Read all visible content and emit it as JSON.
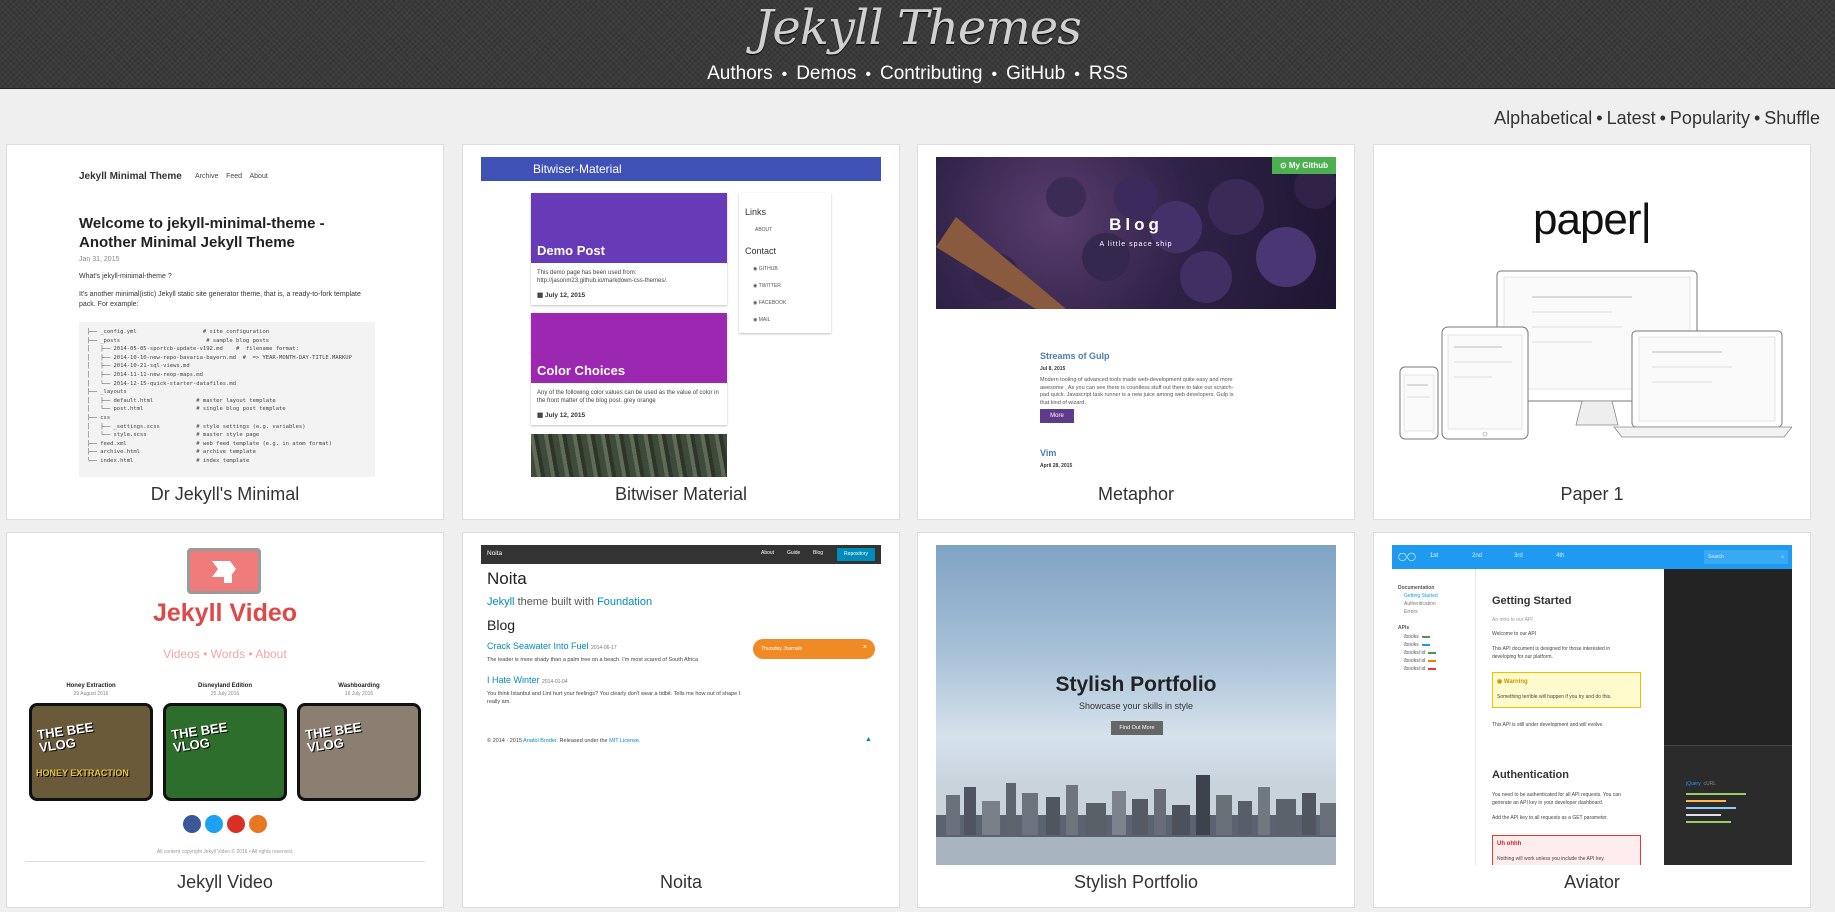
{
  "header": {
    "title": "Jekyll Themes",
    "nav": [
      "Authors",
      "Demos",
      "Contributing",
      "GitHub",
      "RSS"
    ]
  },
  "sort": [
    "Alphabetical",
    "Latest",
    "Popularity",
    "Shuffle"
  ],
  "themes": [
    {
      "title": "Dr Jekyll's Minimal",
      "preview": {
        "brand": "Jekyll Minimal Theme",
        "nav": [
          "Archive",
          "Feed",
          "About"
        ],
        "heading": "Welcome to jekyll-minimal-theme - Another Minimal Jekyll Theme",
        "date": "Jan 31, 2015",
        "whats": "What's jekyll-minimal-theme ?",
        "intro": "It's another minimal(istic) Jekyll static site generator theme, that is, a ready-to-fork template pack. For example:",
        "tree": [
          "├── _config.yml                    # site configuration",
          "├── _posts                          # sample blog posts",
          "│   ├── 2014-05-05-sportcb-update-v192.md    #  filename format:",
          "│   ├── 2014-10-10-new-repo-bavaria-bayern.md  #  => YEAR-MONTH-DAY-TITLE.MARKUP",
          "│   ├── 2014-10-21-sql-views.md",
          "│   ├── 2014-11-11-new-reop-maps.md",
          "│   └── 2014-12-15-quick-starter-datafiles.md",
          "├── _layouts",
          "│   ├── default.html             # master layout template",
          "│   └── post.html                # single blog post template",
          "├── css",
          "│   ├── _settings.scss           # style settings (e.g. variables)",
          "│   └── style.scss               # master style page",
          "├── feed.xml                     # web feed template (e.g. in atom format)",
          "├── archive.html                 # archive template",
          "└── index.html                   # index template"
        ]
      }
    },
    {
      "title": "Bitwiser Material",
      "preview": {
        "bar": "Bitwiser-Material",
        "post1": {
          "title": "Demo Post",
          "text": "This demo page has been used from: http://jasonm23.github.io/markdown-css-themes/.",
          "date": "July 12, 2015"
        },
        "post2": {
          "title": "Color Choices",
          "text": "Any of the following color values can be used as the value of color in the front matter of the blog post. grey orange",
          "date": "July 12, 2015"
        },
        "links_title": "Links",
        "about": "ABOUT",
        "contact_title": "Contact",
        "contacts": [
          "GITHUB",
          "TWITTER",
          "FACEBOOK",
          "MAIL"
        ]
      }
    },
    {
      "title": "Metaphor",
      "preview": {
        "github_button": "My Github",
        "hero_title": "Blog",
        "hero_sub": "A little space ship",
        "post1_title": "Streams of Gulp",
        "post1_date": "Jul 8, 2015",
        "post1_text": "Modern tooling of advanced tools made web-development quite easy and more awesome . As you can see there is countless stuff out there to take our scratch-pad quick. Javascript task runner is a new juice among web developers. Gulp is that kind of wizard.",
        "more": "More",
        "post2_title": "Vim",
        "post2_date": "April 28, 2015"
      }
    },
    {
      "title": "Paper 1",
      "preview": {
        "logo": "paper"
      }
    },
    {
      "title": "Jekyll Video",
      "preview": {
        "brand": "Jekyll Video",
        "nav": [
          "Videos",
          "Words",
          "About"
        ],
        "videos": [
          {
            "title": "Honey Extraction",
            "date": "29 August 2016",
            "thumb_text": "THE BEE VLOG",
            "caption": "HONEY EXTRACTION",
            "bg": "#6a5a3a"
          },
          {
            "title": "Disneyland Edition",
            "date": "25 July 2016",
            "thumb_text": "THE BEE VLOG",
            "caption": "",
            "bg": "#2d6e2d"
          },
          {
            "title": "Washboarding",
            "date": "16 July 2016",
            "thumb_text": "THE BEE VLOG",
            "caption": "",
            "bg": "#8a7f70"
          }
        ],
        "footer": "All content copyright Jekyll Video © 2016 • All rights reserved."
      }
    },
    {
      "title": "Noita",
      "preview": {
        "brand": "Noita",
        "nav": [
          "About",
          "Guide",
          "Blog"
        ],
        "repo_button": "Repository",
        "heading": "Noita",
        "tagline_a": "Jekyll",
        "tagline_b": " theme built with ",
        "tagline_c": "Foundation",
        "blog": "Blog",
        "post1_title": "Crack Seawater Into Fuel",
        "post1_date": "2014-06-17",
        "post1_text": "The leader is more shady than a palm tree on a beach. I'm most scared of South Africa",
        "post2_title": "I Hate Winter",
        "post2_date": "2014-01-04",
        "post2_text": "You think Istanbul and Lint hurt your feelings? You clearly don't wear a tidbit. Tells me how out of shape I really am.",
        "alert": "Thursday Journals",
        "footer_a": "© 2014 · 2015 ",
        "footer_b": "Anatol Broder",
        "footer_c": ". Released under the ",
        "footer_d": "MIT License",
        "footer_e": "."
      }
    },
    {
      "title": "Stylish Portfolio",
      "preview": {
        "hero_title": "Stylish Portfolio",
        "hero_sub": "Showcase your skills in style",
        "button": "Find Out More"
      }
    },
    {
      "title": "Aviator",
      "preview": {
        "tabs": [
          "1st",
          "2nd",
          "3rd",
          "4th"
        ],
        "search": "Search",
        "sidebar_title": "Documentation",
        "sidebar_items": [
          "Getting Started",
          "Authentication",
          "Errors"
        ],
        "api_title": "APIs",
        "api_items": [
          "/books",
          "/books",
          "/books/:id",
          "/books/:id",
          "/books/:id"
        ],
        "h1": "Getting Started",
        "p1": "An intro to our API",
        "p2": "Welcome to our API",
        "p3": "This API document is designed for those interested in developing for our platform.",
        "warn_title": "Warning",
        "warn_text": "Something terrible will happen if you try and do this.",
        "p4": "This API is still under development and will evolve.",
        "h2": "Authentication",
        "p5": "You need to be authenticated for all API requests. You can generate an API key in your developer dashboard.",
        "p6": "Add the API key to all requests as a GET parameter.",
        "err_title": "Uh ohhh",
        "err_text": "Nothing will work unless you include the API key.",
        "code_label": "jQuery",
        "code_label2": "cURL"
      }
    }
  ]
}
